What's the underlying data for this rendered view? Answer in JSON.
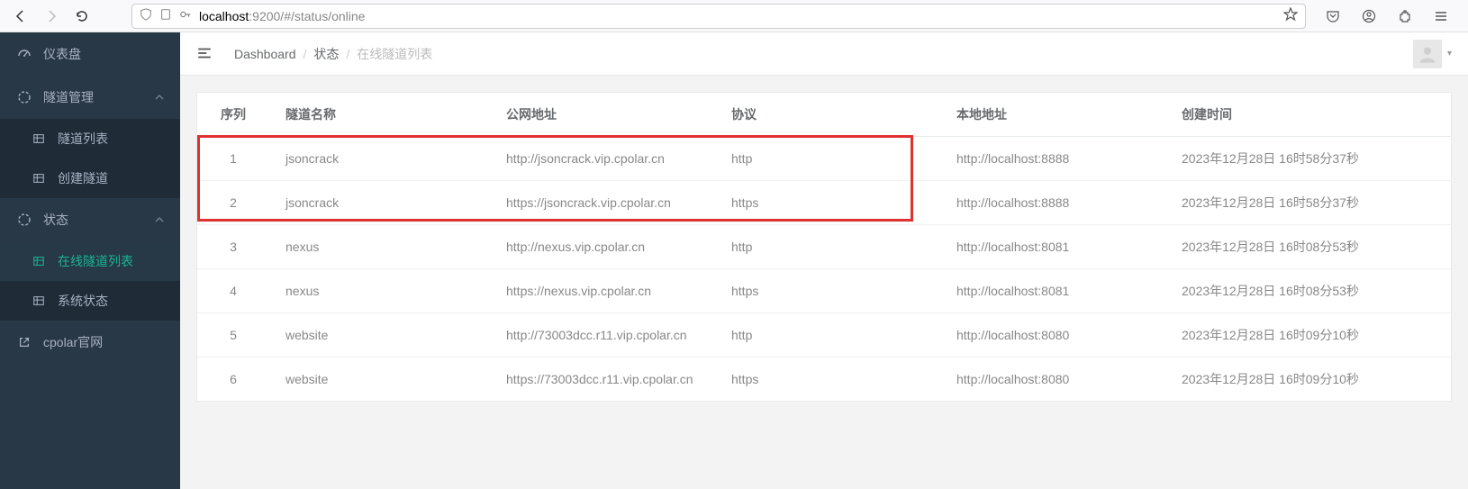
{
  "browser": {
    "url_host": "localhost",
    "url_rest": ":9200/#/status/online"
  },
  "sidebar": {
    "dashboard": "仪表盘",
    "tunnel_mgmt": "隧道管理",
    "tunnel_list": "隧道列表",
    "create_tunnel": "创建隧道",
    "status": "状态",
    "online_tunnels": "在线隧道列表",
    "system_status": "系统状态",
    "cpolar_site": "cpolar官网"
  },
  "breadcrumb": {
    "dashboard": "Dashboard",
    "status": "状态",
    "current": "在线隧道列表"
  },
  "table": {
    "headers": {
      "idx": "序列",
      "name": "隧道名称",
      "url": "公网地址",
      "proto": "协议",
      "local": "本地地址",
      "created": "创建时间"
    },
    "rows": [
      {
        "idx": "1",
        "name": "jsoncrack",
        "url": "http://jsoncrack.vip.cpolar.cn",
        "proto": "http",
        "local": "http://localhost:8888",
        "created": "2023年12月28日 16时58分37秒"
      },
      {
        "idx": "2",
        "name": "jsoncrack",
        "url": "https://jsoncrack.vip.cpolar.cn",
        "proto": "https",
        "local": "http://localhost:8888",
        "created": "2023年12月28日 16时58分37秒"
      },
      {
        "idx": "3",
        "name": "nexus",
        "url": "http://nexus.vip.cpolar.cn",
        "proto": "http",
        "local": "http://localhost:8081",
        "created": "2023年12月28日 16时08分53秒"
      },
      {
        "idx": "4",
        "name": "nexus",
        "url": "https://nexus.vip.cpolar.cn",
        "proto": "https",
        "local": "http://localhost:8081",
        "created": "2023年12月28日 16时08分53秒"
      },
      {
        "idx": "5",
        "name": "website",
        "url": "http://73003dcc.r11.vip.cpolar.cn",
        "proto": "http",
        "local": "http://localhost:8080",
        "created": "2023年12月28日 16时09分10秒"
      },
      {
        "idx": "6",
        "name": "website",
        "url": "https://73003dcc.r11.vip.cpolar.cn",
        "proto": "https",
        "local": "http://localhost:8080",
        "created": "2023年12月28日 16时09分10秒"
      }
    ]
  }
}
